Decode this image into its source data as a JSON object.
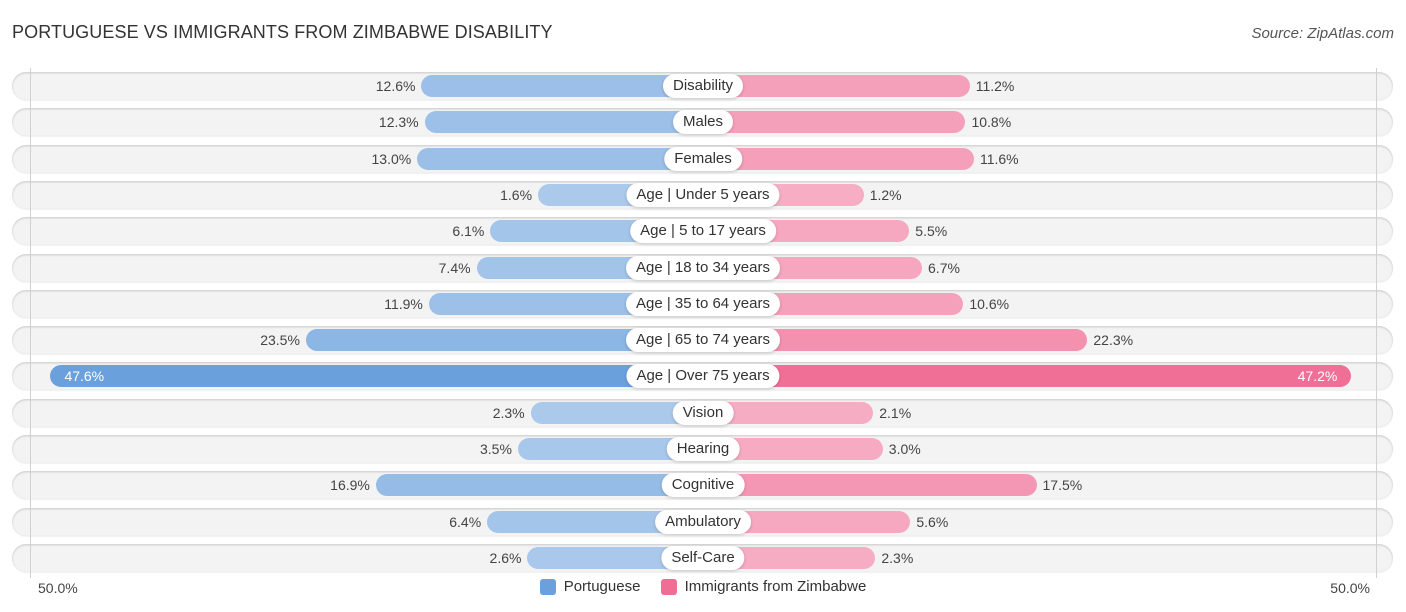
{
  "header": {
    "title": "PORTUGUESE VS IMMIGRANTS FROM ZIMBABWE DISABILITY",
    "source": "Source: ZipAtlas.com"
  },
  "colors": {
    "portuguese": "#6aa0dc",
    "zimbabwe": "#f06e96"
  },
  "chart_data": {
    "type": "bar",
    "orientation": "horizontal-diverging",
    "title": "PORTUGUESE VS IMMIGRANTS FROM ZIMBABWE DISABILITY",
    "categories": [
      "Disability",
      "Males",
      "Females",
      "Age | Under 5 years",
      "Age | 5 to 17 years",
      "Age | 18 to 34 years",
      "Age | 35 to 64 years",
      "Age | 65 to 74 years",
      "Age | Over 75 years",
      "Vision",
      "Hearing",
      "Cognitive",
      "Ambulatory",
      "Self-Care"
    ],
    "series": [
      {
        "name": "Portuguese",
        "side": "left",
        "values": [
          12.6,
          12.3,
          13.0,
          1.6,
          6.1,
          7.4,
          11.9,
          23.5,
          47.6,
          2.3,
          3.5,
          16.9,
          6.4,
          2.6
        ]
      },
      {
        "name": "Immigrants from Zimbabwe",
        "side": "right",
        "values": [
          11.2,
          10.8,
          11.6,
          1.2,
          5.5,
          6.7,
          10.6,
          22.3,
          47.2,
          2.1,
          3.0,
          17.5,
          5.6,
          2.3
        ]
      }
    ],
    "value_labels_left": [
      "12.6%",
      "12.3%",
      "13.0%",
      "1.6%",
      "6.1%",
      "7.4%",
      "11.9%",
      "23.5%",
      "47.6%",
      "2.3%",
      "3.5%",
      "16.9%",
      "6.4%",
      "2.6%"
    ],
    "value_labels_right": [
      "11.2%",
      "10.8%",
      "11.6%",
      "1.2%",
      "5.5%",
      "6.7%",
      "10.6%",
      "22.3%",
      "47.2%",
      "2.1%",
      "3.0%",
      "17.5%",
      "5.6%",
      "2.3%"
    ],
    "xlim": [
      -50,
      50
    ],
    "axis_tick_labels": {
      "left": "50.0%",
      "right": "50.0%"
    },
    "legend": [
      "Portuguese",
      "Immigrants from Zimbabwe"
    ],
    "legend_position": "bottom-center",
    "grid": false
  }
}
